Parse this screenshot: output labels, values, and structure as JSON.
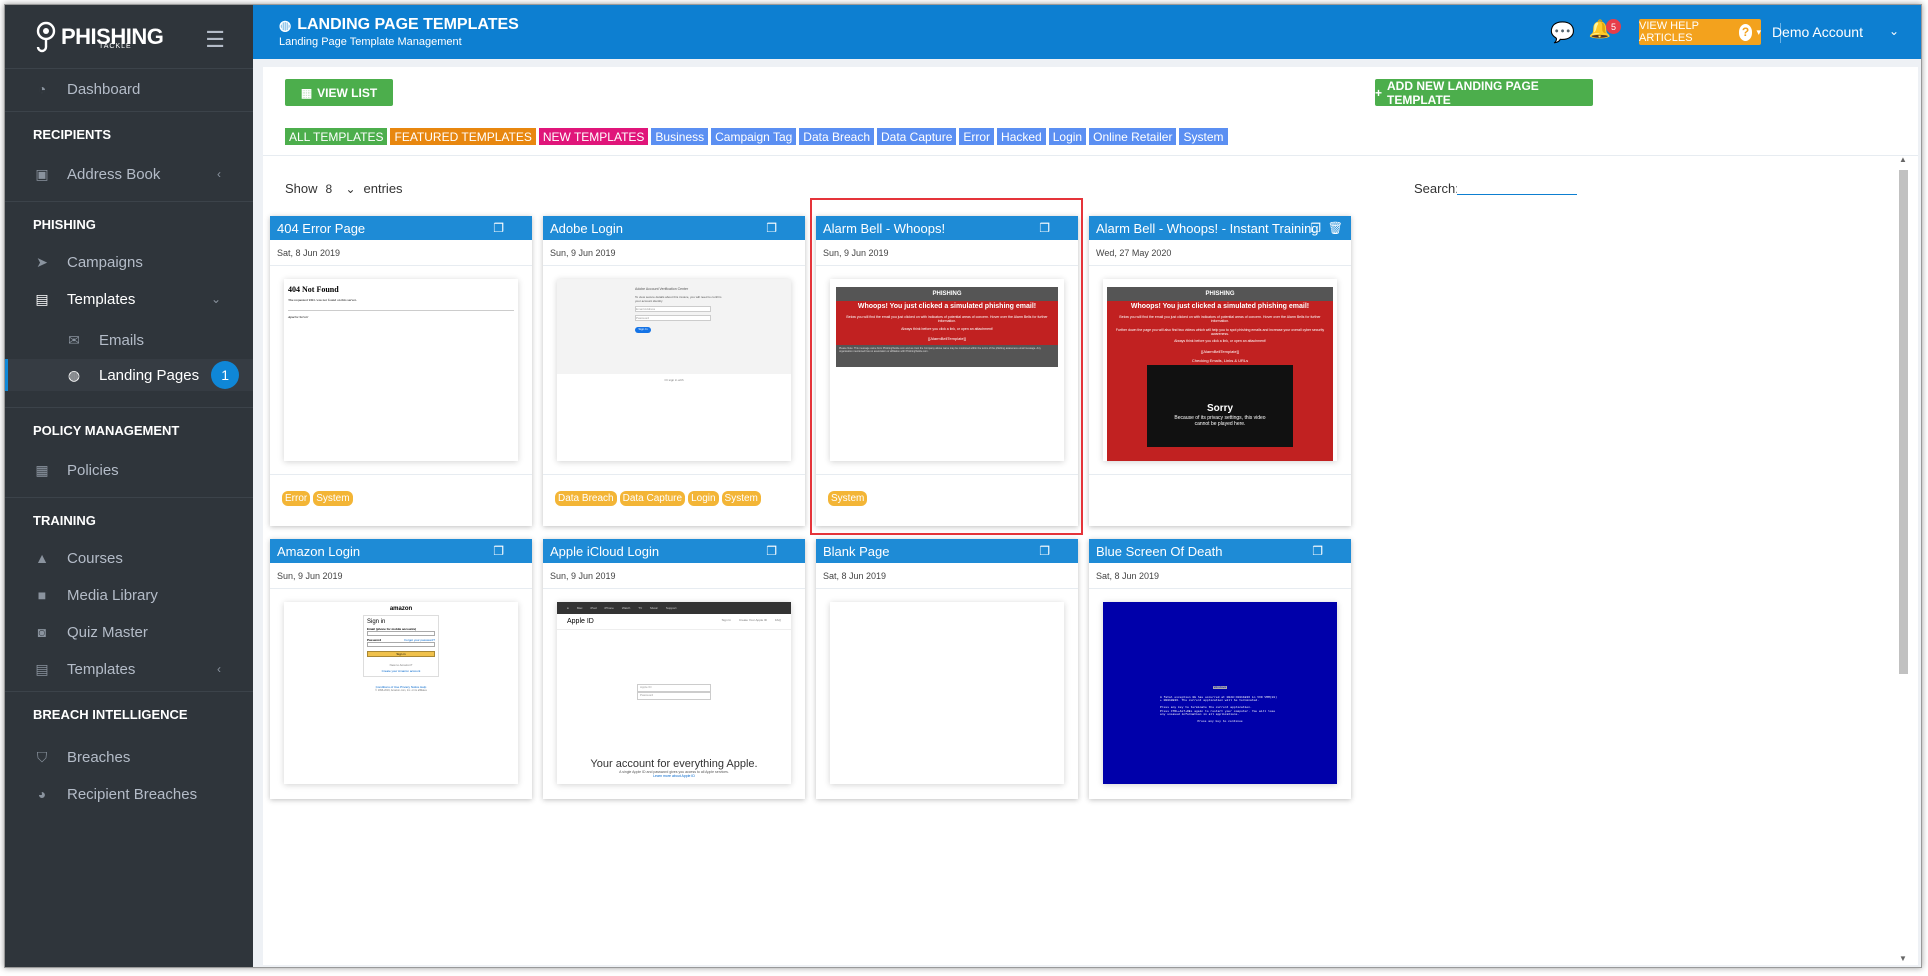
{
  "sidebar": {
    "logo_text": "PHISHING",
    "logo_sub": "TACKLE",
    "items": [
      {
        "label": "Dashboard"
      },
      {
        "section": "RECIPIENTS"
      },
      {
        "label": "Address Book"
      },
      {
        "section": "PHISHING"
      },
      {
        "label": "Campaigns"
      },
      {
        "label": "Templates"
      },
      {
        "label": "Emails"
      },
      {
        "label": "Landing Pages",
        "badge": "1"
      },
      {
        "section": "POLICY MANAGEMENT"
      },
      {
        "label": "Policies"
      },
      {
        "section": "TRAINING"
      },
      {
        "label": "Courses"
      },
      {
        "label": "Media Library"
      },
      {
        "label": "Quiz Master"
      },
      {
        "label": "Templates"
      },
      {
        "section": "BREACH INTELLIGENCE"
      },
      {
        "label": "Breaches"
      },
      {
        "label": "Recipient Breaches"
      }
    ]
  },
  "header": {
    "title": "LANDING PAGE TEMPLATES",
    "subtitle": "Landing Page Template Management",
    "notifications": "5",
    "help_label": "VIEW HELP ARTICLES",
    "account": "Demo Account"
  },
  "toolbar": {
    "view_list": "VIEW LIST",
    "add_new": "ADD NEW LANDING PAGE TEMPLATE"
  },
  "filters": [
    {
      "label": "ALL TEMPLATES",
      "color": "#4cae4c"
    },
    {
      "label": "FEATURED TEMPLATES",
      "color": "#e8870f"
    },
    {
      "label": "NEW TEMPLATES",
      "color": "#e0157a"
    },
    {
      "label": "Business",
      "color": "#5b8ff2"
    },
    {
      "label": "Campaign Tag",
      "color": "#5b8ff2"
    },
    {
      "label": "Data Breach",
      "color": "#5b8ff2"
    },
    {
      "label": "Data Capture",
      "color": "#5b8ff2"
    },
    {
      "label": "Error",
      "color": "#5b8ff2"
    },
    {
      "label": "Hacked",
      "color": "#5b8ff2"
    },
    {
      "label": "Login",
      "color": "#5b8ff2"
    },
    {
      "label": "Online Retailer",
      "color": "#5b8ff2"
    },
    {
      "label": "System",
      "color": "#5b8ff2"
    }
  ],
  "table": {
    "show_label": "Show",
    "entries_value": "8",
    "entries_label": "entries",
    "search_label": "Search:",
    "search_value": ""
  },
  "cards": [
    {
      "title": "404 Error Page",
      "date": "Sat, 8 Jun 2019",
      "tags": [
        "Error",
        "System"
      ],
      "preview": {
        "h": "404 Not Found",
        "p": "The requested URL was not found on this server.",
        "f": "Apache Server"
      }
    },
    {
      "title": "Adobe Login",
      "date": "Sun, 9 Jun 2019",
      "tags": [
        "Data Breach",
        "Data Capture",
        "Login",
        "System"
      ],
      "preview": {
        "h": "Adobe Account Verification Center",
        "p": "To view secure details about this invoice, you will need to confirm your account identity",
        "email": "Email Address",
        "pwd": "Password",
        "btn": "Sign In",
        "f": "Or sign in with"
      }
    },
    {
      "title": "Alarm Bell - Whoops!",
      "date": "Sun, 9 Jun 2019",
      "tags": [
        "System"
      ],
      "preview": {
        "logo": "PHISHING",
        "h": "Whoops! You just clicked a simulated phishing email!",
        "p1": "Below you will find the email you just clicked on with indicators of potential areas of concern.  Hover over the Alarm Bells for further information.",
        "p2": "Always think before you click a link, or open an attachment!",
        "p3": "[[AlarmBellTemplate]]",
        "f": "Please Note: This message came from PhishingTackle.com and we trust the Company above name may be monitored within the terms of the phishing awareness email message. Any organisation mentioned has no association or affiliation with PhishingTackle.com."
      }
    },
    {
      "title": "Alarm Bell - Whoops! - Instant Training",
      "date": "Wed, 27 May 2020",
      "tags": [],
      "preview": {
        "logo": "PHISHING",
        "h": "Whoops! You just clicked a simulated phishing email!",
        "p1": "Below you will find the email you just clicked on with indicators of potential areas of concern.  Hover over the Alarm Bells for further information.",
        "p2": "Further down the page you will also find two videos which will help you to spot phishing emails and increase your overall cyber security awareness.",
        "p3": "Always think before you click a link, or open an attachment!",
        "p4": "[[AlarmBellTemplate]]",
        "p5": "Checking Emails, Links & URLs",
        "v1": "Sorry",
        "v2": "Because of its privacy settings, this video cannot be played here."
      }
    },
    {
      "title": "Amazon Login",
      "date": "Sun, 9 Jun 2019",
      "tags": [],
      "preview": {
        "logo": "amazon",
        "h": "Sign in",
        "l1": "Email (phone for mobile accounts)",
        "l2": "Password",
        "l3": "Forgot your password?",
        "btn": "Sign in",
        "n": "New to Amazon?",
        "c": "Create your Amazon account",
        "f": "Conditions of Use    Privacy Notice    Help",
        "f2": "© 1996-2019, Amazon.com, Inc. or its affiliates"
      }
    },
    {
      "title": "Apple iCloud Login",
      "date": "Sun, 9 Jun 2019",
      "tags": [],
      "preview": {
        "nav": [
          "Mac",
          "iPad",
          "iPhone",
          "Watch",
          "TV",
          "Music",
          "Support"
        ],
        "h": "Apple ID",
        "r1": "Sign In",
        "r2": "Create Your Apple ID",
        "r3": "FAQ",
        "i1": "Apple ID",
        "i2": "Password",
        "big": "Your account for everything Apple.",
        "s": "A single Apple ID and password gives you access to all Apple services.",
        "l": "Learn more about Apple ID"
      }
    },
    {
      "title": "Blank Page",
      "date": "Sat, 8 Jun 2019",
      "tags": [],
      "preview": {}
    },
    {
      "title": "Blue Screen Of Death",
      "date": "Sat, 8 Jun 2019",
      "tags": [],
      "preview": {
        "t": "Windows",
        "p": "A fatal exception 0E has occurred at 0028:C0011E36 in VXD VMM(01) + 00010E36. The current application will be terminated.",
        "b1": "Press any key to terminate the current application.",
        "b2": "Press CTRL+ALT+DEL again to restart your computer. You will lose any unsaved information in all applications.",
        "c": "Press any key to continue"
      }
    }
  ]
}
